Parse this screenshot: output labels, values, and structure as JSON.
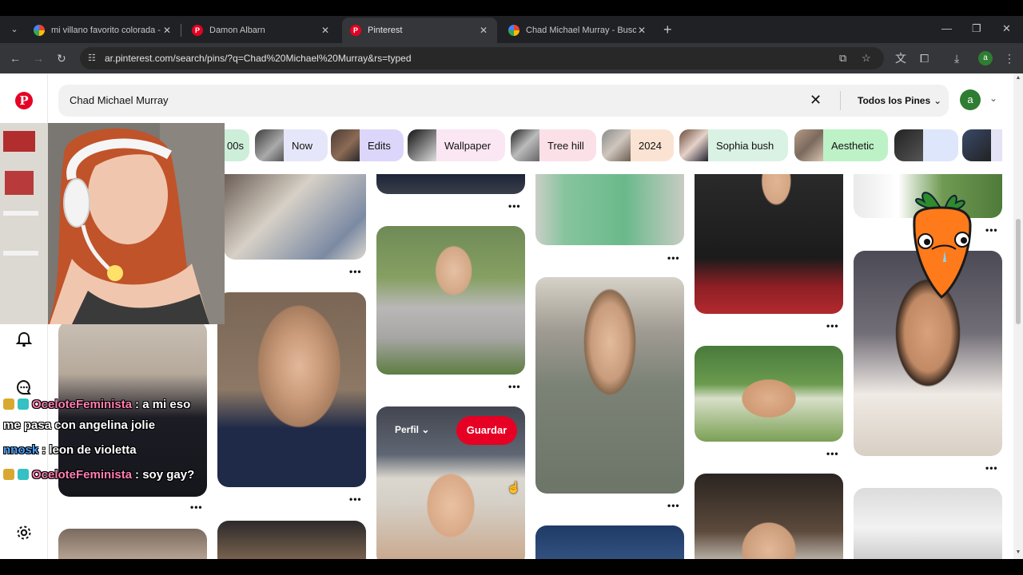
{
  "browser": {
    "tabs": [
      {
        "title": "mi villano favorito colorada - B",
        "favicon": "google-favicon",
        "active": false
      },
      {
        "title": "Damon Albarn",
        "favicon": "pinterest-favicon",
        "active": false
      },
      {
        "title": "Pinterest",
        "favicon": "pinterest-favicon",
        "active": true
      },
      {
        "title": "Chad Michael Murray - Buscar c",
        "favicon": "google-favicon",
        "active": false
      }
    ],
    "url": "ar.pinterest.com/search/pins/?q=Chad%20Michael%20Murray&rs=typed",
    "profile_letter": "a"
  },
  "pinterest": {
    "search_query": "Chad Michael Murray",
    "filter_label": "Todos los Pines",
    "avatar_letter": "a",
    "chips": [
      {
        "label": "00s",
        "color": "#cdeed9"
      },
      {
        "label": "Now",
        "color": "#e6e6fa"
      },
      {
        "label": "Edits",
        "color": "#dcd6fa"
      },
      {
        "label": "Wallpaper",
        "color": "#fbe6f4"
      },
      {
        "label": "Tree hill",
        "color": "#fbe0e8"
      },
      {
        "label": "2024",
        "color": "#fbe3d3"
      },
      {
        "label": "Sophia bush",
        "color": "#d9f2e4"
      },
      {
        "label": "Aesthetic",
        "color": "#bdf2c7"
      }
    ],
    "hover_pin": {
      "board_label": "Perfil",
      "save_label": "Guardar"
    },
    "brand_color": "#e60023"
  },
  "chat": [
    {
      "user": "OceloteFeminista",
      "message": ": a mi eso",
      "user_color": "#ff7fb2"
    },
    {
      "user": "",
      "message": "me pasa con angelina jolie",
      "user_color": "#ffffff"
    },
    {
      "user": "nnosk",
      "message": ": leon de violetta",
      "user_color": "#4aa3ff"
    },
    {
      "user": "OceloteFeminista",
      "message": ": soy gay?",
      "user_color": "#ff7fb2"
    }
  ]
}
